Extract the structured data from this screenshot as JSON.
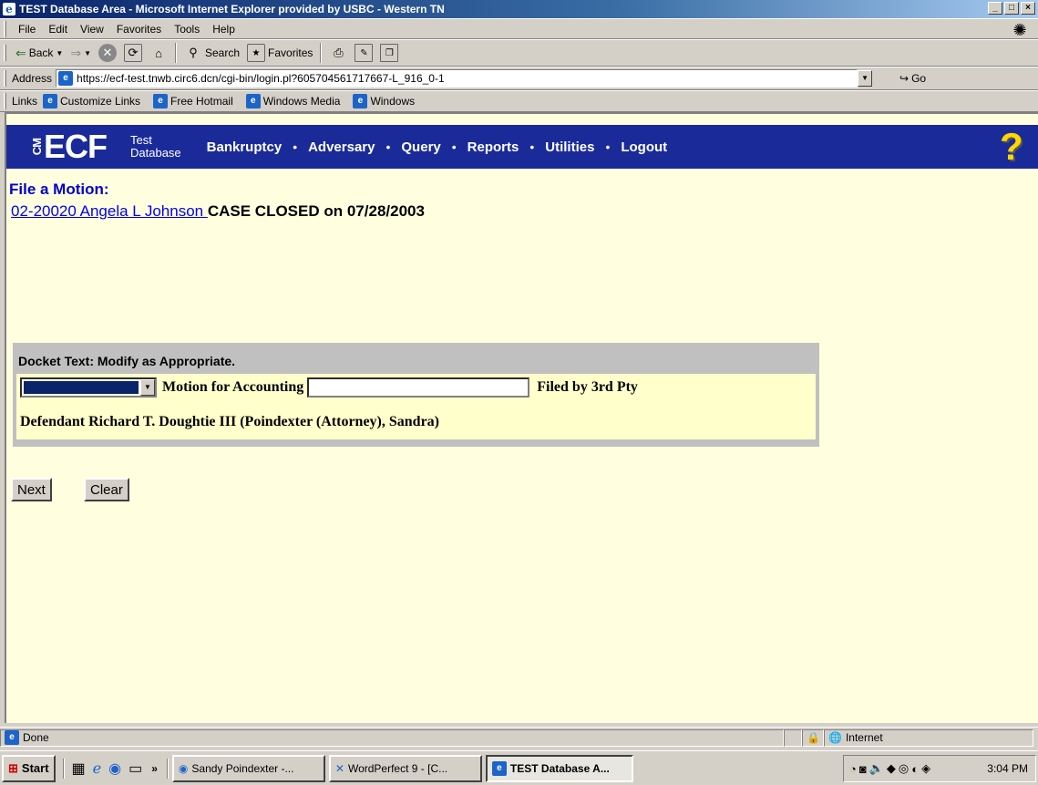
{
  "window": {
    "title": "TEST Database Area - Microsoft Internet Explorer provided by USBC - Western TN",
    "min": "_",
    "max": "□",
    "close": "×"
  },
  "menu": [
    "File",
    "Edit",
    "View",
    "Favorites",
    "Tools",
    "Help"
  ],
  "toolbar": {
    "back": "Back",
    "search": "Search",
    "favorites": "Favorites"
  },
  "address": {
    "label": "Address",
    "url": "https://ecf-test.tnwb.circ6.dcn/cgi-bin/login.pl?605704561717667-L_916_0-1",
    "go": "Go"
  },
  "links": {
    "label": "Links",
    "items": [
      "Customize Links",
      "Free Hotmail",
      "Windows Media",
      "Windows"
    ]
  },
  "ecf": {
    "logo": "ECF",
    "logo_cm": "CM",
    "test_line1": "Test",
    "test_line2": "Database",
    "nav": [
      "Bankruptcy",
      "Adversary",
      "Query",
      "Reports",
      "Utilities",
      "Logout"
    ],
    "help": "?"
  },
  "page": {
    "title": "File a Motion:",
    "case_link": "02-20020 Angela L Johnson ",
    "case_status": "CASE CLOSED on 07/28/2003"
  },
  "docket": {
    "heading": "Docket Text: Modify as Appropriate.",
    "motion_text": "Motion for Accounting",
    "input_value": "",
    "filed_by": "Filed by 3rd Pty",
    "line2": "Defendant Richard T. Doughtie III (Poindexter (Attorney), Sandra)"
  },
  "buttons": {
    "next": "Next",
    "clear": "Clear"
  },
  "status": {
    "text": "Done",
    "zone": "Internet"
  },
  "taskbar": {
    "start": "Start",
    "tasks": [
      "Sandy Poindexter -...",
      "WordPerfect 9 - [C...",
      "TEST Database A..."
    ],
    "clock": "3:04 PM"
  }
}
